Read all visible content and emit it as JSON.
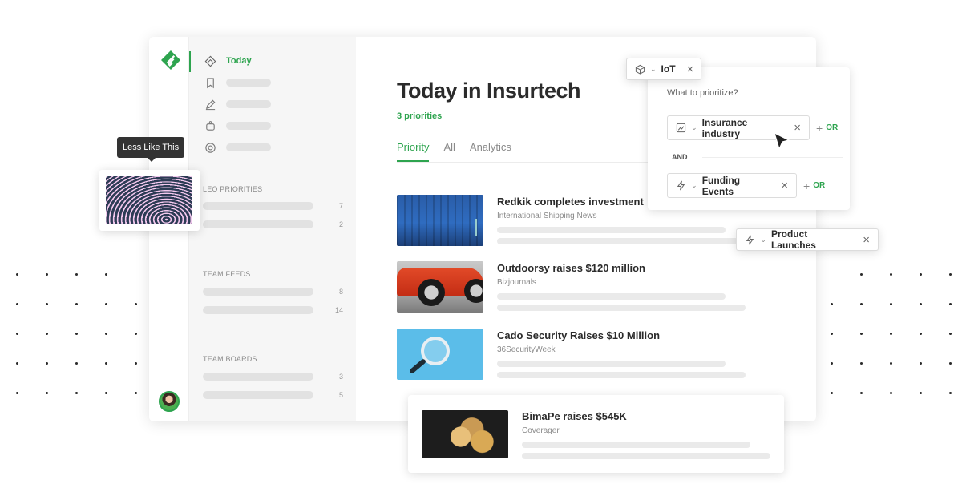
{
  "tooltip": {
    "text": "Less Like This"
  },
  "sidebar": {
    "today_label": "Today",
    "sections": [
      {
        "title": "LEO PRIORITIES",
        "counts": [
          "7",
          "2"
        ]
      },
      {
        "title": "TEAM FEEDS",
        "counts": [
          "8",
          "14"
        ]
      },
      {
        "title": "TEAM BOARDS",
        "counts": [
          "3",
          "5"
        ]
      }
    ]
  },
  "main": {
    "title": "Today in Insurtech",
    "priorities": "3 priorities",
    "tabs": [
      "Priority",
      "All",
      "Analytics"
    ],
    "articles": [
      {
        "title": "Redkik completes investment",
        "source": "International Shipping News"
      },
      {
        "title": "Outdoorsy raises $120 million",
        "source": "Bizjournals"
      },
      {
        "title": "Cado Security Raises $10 Million",
        "source": "36SecurityWeek"
      }
    ]
  },
  "floating_article": {
    "title": "BimaPe raises $545K",
    "source": "Coverager"
  },
  "iot_chip": {
    "label": "IoT"
  },
  "prioritize_panel": {
    "question": "What to prioritize?",
    "filter1": "Insurance industry",
    "or_label": "OR",
    "and_label": "AND",
    "filter2": "Funding Events"
  },
  "product_chip": {
    "label": "Product Launches"
  },
  "colors": {
    "accent": "#2ea44f",
    "text": "#2b2b2b",
    "muted": "#8a8a8a"
  }
}
